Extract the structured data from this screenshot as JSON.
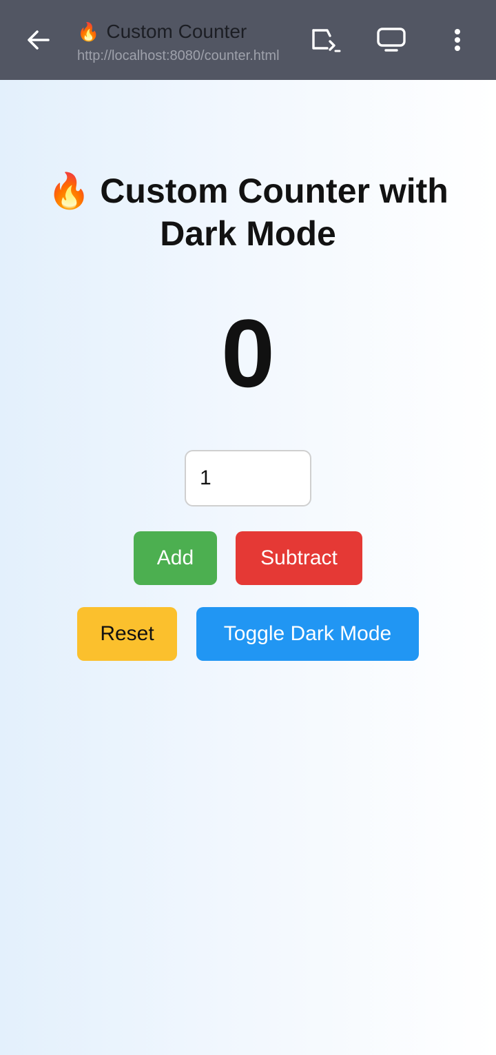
{
  "browser": {
    "tab_favicon": "🔥",
    "tab_title": "Custom Counter",
    "url": "http://localhost:8080/counter.html",
    "icons": {
      "back": "back-arrow-icon",
      "cast": "cast-icon",
      "screen": "tv-icon",
      "menu": "more-vert-icon"
    }
  },
  "page": {
    "heading_line1": "🔥 Custom Counter with",
    "heading_line2": "Dark Mode",
    "counter_value": "0",
    "step_input_value": "1",
    "buttons": {
      "add": "Add",
      "subtract": "Subtract",
      "reset": "Reset",
      "toggle_dark": "Toggle Dark Mode"
    }
  },
  "colors": {
    "topbar": "#525663",
    "add": "#4caf50",
    "subtract": "#e53935",
    "reset": "#fbc02d",
    "toggle_dark": "#2196f3"
  }
}
